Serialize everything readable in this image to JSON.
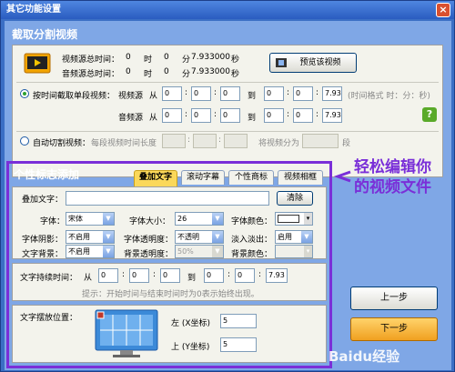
{
  "window": {
    "title": "其它功能设置",
    "close": "×"
  },
  "split": {
    "section_title": "截取分割视频",
    "video_total_label": "视频源总时间：",
    "audio_total_label": "音频源总时间：",
    "video_total": {
      "h": "0",
      "h_unit": "时",
      "m": "0",
      "m_unit": "分",
      "s": "7.933000",
      "s_unit": "秒"
    },
    "audio_total": {
      "h": "0",
      "h_unit": "时",
      "m": "0",
      "m_unit": "分",
      "s": "7.933000",
      "s_unit": "秒"
    },
    "preview_button": "预览该视频",
    "by_time_label": "按时间截取单段视频：",
    "video_source_label": "视频源",
    "audio_source_label": "音频源",
    "from": "从",
    "to": "到",
    "video_from": [
      "0",
      "0",
      "0"
    ],
    "video_to": [
      "0",
      "0",
      "7.93"
    ],
    "audio_from": [
      "0",
      "0",
      "0"
    ],
    "audio_to": [
      "0",
      "0",
      "7.93"
    ],
    "time_format_hint": "(时间格式 时：分：秒)",
    "auto_cut_label": "自动切割视频：",
    "segment_len_label": "每段视频时间长度",
    "split_into_label": "将视频分为",
    "segment_unit": "段"
  },
  "overlay": {
    "section_title": "个性标志添加",
    "tabs": [
      "叠加文字",
      "滚动字幕",
      "个性商标",
      "视频相框"
    ],
    "text_label": "叠加文字：",
    "text_value": "",
    "clear_button": "清除",
    "font_label": "字体：",
    "font_value": "宋体",
    "size_label": "字体大小：",
    "size_value": "26",
    "color_label": "字体颜色：",
    "shadow_label": "字体阴影：",
    "shadow_value": "不启用",
    "opacity_label": "字体透明度：",
    "opacity_value": "不透明",
    "fade_label": "淡入淡出：",
    "fade_value": "启用",
    "bg_label": "文字背景：",
    "bg_value": "不启用",
    "bg_opacity_label": "背景透明度：",
    "bg_opacity_value": "50%",
    "bg_color_label": "背景颜色：",
    "duration_label": "文字持续时间：",
    "from": "从",
    "to": "到",
    "duration_from": [
      "0",
      "0",
      "0"
    ],
    "duration_to": [
      "0",
      "0",
      "7.93"
    ],
    "hint": "提示：开始时间与结束时间时为0表示始终出现。",
    "position_label": "文字摆放位置：",
    "left_label": "左 (X坐标)",
    "left_value": "5",
    "top_label": "上 (Y坐标)",
    "top_value": "5"
  },
  "annotation": {
    "line1": "轻松编辑你",
    "line2": "的视频文件"
  },
  "footer": {
    "prev_button": "上一步",
    "next_button": "下一步"
  },
  "watermark": {
    "text": "Baidu经验"
  }
}
